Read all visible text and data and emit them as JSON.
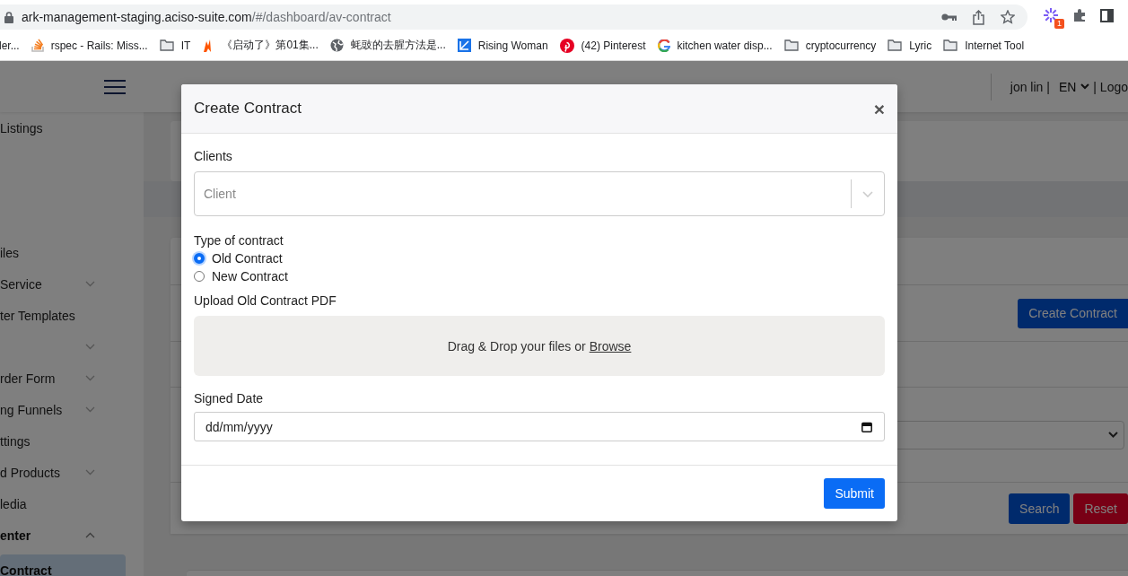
{
  "browser": {
    "url_host": "ark-management-staging.aciso-suite.com",
    "url_path": "/#/dashboard/av-contract",
    "extension_badge": "1",
    "bookmarks": [
      {
        "label": "ler...",
        "kind": "none"
      },
      {
        "label": "rspec - Rails: Miss...",
        "kind": "stack"
      },
      {
        "label": "IT",
        "kind": "folder"
      },
      {
        "label": "《启动了》第01集...",
        "kind": "flame"
      },
      {
        "label": "蚝豉的去腥方法是...",
        "kind": "globe"
      },
      {
        "label": "Rising Woman",
        "kind": "square"
      },
      {
        "label": "(42) Pinterest",
        "kind": "pin"
      },
      {
        "label": "kitchen water disp...",
        "kind": "google"
      },
      {
        "label": "cryptocurrency",
        "kind": "folder"
      },
      {
        "label": "Lyric",
        "kind": "folder"
      },
      {
        "label": "Internet Tool",
        "kind": "folder"
      }
    ]
  },
  "header": {
    "user": "jon lin |",
    "language": "EN",
    "logout": "| Logo"
  },
  "sidebar": {
    "items": [
      {
        "label": "Listings",
        "expandable": false,
        "selected": false,
        "bold": false
      },
      {
        "label": "iles",
        "expandable": false,
        "selected": false,
        "bold": false
      },
      {
        "label": "Service",
        "expandable": true,
        "expanded": false,
        "selected": false,
        "bold": false
      },
      {
        "label": "ter Templates",
        "expandable": false,
        "selected": false,
        "bold": false
      },
      {
        "expandable": true,
        "expanded": false,
        "selected": false
      },
      {
        "label": "rder Form",
        "expandable": true,
        "expanded": false,
        "selected": false,
        "bold": false
      },
      {
        "label": "ng Funnels",
        "expandable": true,
        "expanded": false,
        "selected": false,
        "bold": false
      },
      {
        "label": "ttings",
        "expandable": false,
        "selected": false,
        "bold": false
      },
      {
        "label": "d Products",
        "expandable": true,
        "expanded": false,
        "selected": false,
        "bold": false
      },
      {
        "label": "ledia",
        "expandable": false,
        "selected": false,
        "bold": false
      },
      {
        "label": "enter",
        "expandable": true,
        "expanded": true,
        "selected": false,
        "bold": true
      },
      {
        "label": "Contract",
        "expandable": false,
        "selected": true,
        "bold": true
      }
    ]
  },
  "page": {
    "create_button": "Create Contract",
    "search_button": "Search",
    "reset_button": "Reset"
  },
  "modal": {
    "title": "Create Contract",
    "close": "×",
    "clients_label": "Clients",
    "client_placeholder": "Client",
    "type_label": "Type of contract",
    "contract_types": [
      {
        "label": "Old Contract",
        "selected": true
      },
      {
        "label": "New Contract",
        "selected": false
      }
    ],
    "upload_label": "Upload Old Contract PDF",
    "dropzone_text": "Drag & Drop your files or",
    "browse_link": "Browse",
    "signed_date_label": "Signed Date",
    "date_placeholder": "dd/mm/yyyy",
    "submit": "Submit"
  }
}
